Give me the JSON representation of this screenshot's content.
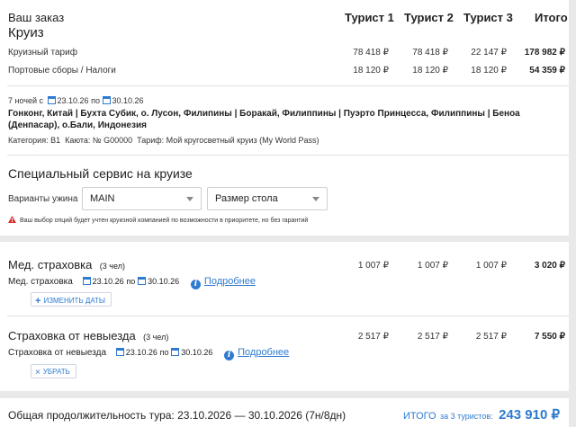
{
  "order": {
    "title": "Ваш заказ",
    "subtitle": "Круиз",
    "columns": [
      "Турист 1",
      "Турист 2",
      "Турист 3",
      "Итого"
    ],
    "rows": [
      {
        "label": "Круизный тариф",
        "values": [
          "78 418 ₽",
          "78 418 ₽",
          "22 147 ₽",
          "178 982 ₽"
        ]
      },
      {
        "label": "Портовые сборы / Налоги",
        "values": [
          "18 120 ₽",
          "18 120 ₽",
          "18 120 ₽",
          "54 359 ₽"
        ]
      }
    ]
  },
  "cruise": {
    "nights_prefix": "7 ночей с",
    "date_from": "23.10.26",
    "date_sep": "по",
    "date_to": "30.10.26",
    "route_line1": "Гонконг, Китай | Бухта Субик, о. Лусон, Филипины | Боракай, Филиппины | Пуэрто Принцесса, Филиппины | Беноа",
    "route_line2": "(Денпасар), о.Бали, Индонезия",
    "details": "Категория: B1  Каюта: № G00000  Тариф: Мой кругосветный круиз (My World Pass)"
  },
  "service": {
    "title": "Специальный сервис на круизе",
    "dinner_label": "Варианты ужина",
    "dinner_value": "MAIN",
    "table_value": "Размер стола",
    "warning": "Ваш выбор опций будет учтен круизной компанией по возможности в приоритете, но без гарантий"
  },
  "med": {
    "title": "Мед. страховка",
    "count": "(3 чел)",
    "values": [
      "1 007 ₽",
      "1 007 ₽",
      "1 007 ₽",
      "3 020 ₽"
    ],
    "sub_label": "Мед. страховка",
    "date_from": "23.10.26",
    "date_sep": "по",
    "date_to": "30.10.26",
    "more": "Подробнее",
    "button": "ИЗМЕНИТЬ ДАТЫ"
  },
  "cancel": {
    "title": "Страховка от невыезда",
    "count": "(3 чел)",
    "values": [
      "2 517 ₽",
      "2 517 ₽",
      "2 517 ₽",
      "7 550 ₽"
    ],
    "sub_label": "Страховка от невыезда",
    "date_from": "23.10.26",
    "date_sep": "по",
    "date_to": "30.10.26",
    "more": "Подробнее",
    "button": "УБРАТЬ"
  },
  "footer": {
    "duration": "Общая продолжительность тура: 23.10.2026 — 30.10.2026 (7н/8дн)",
    "total_label": "ИТОГО",
    "total_for": "за 3 туристов:",
    "total_value": "243 910 ₽"
  },
  "colors": {
    "accent": "#2f7bd0",
    "warning": "#d9302c"
  }
}
